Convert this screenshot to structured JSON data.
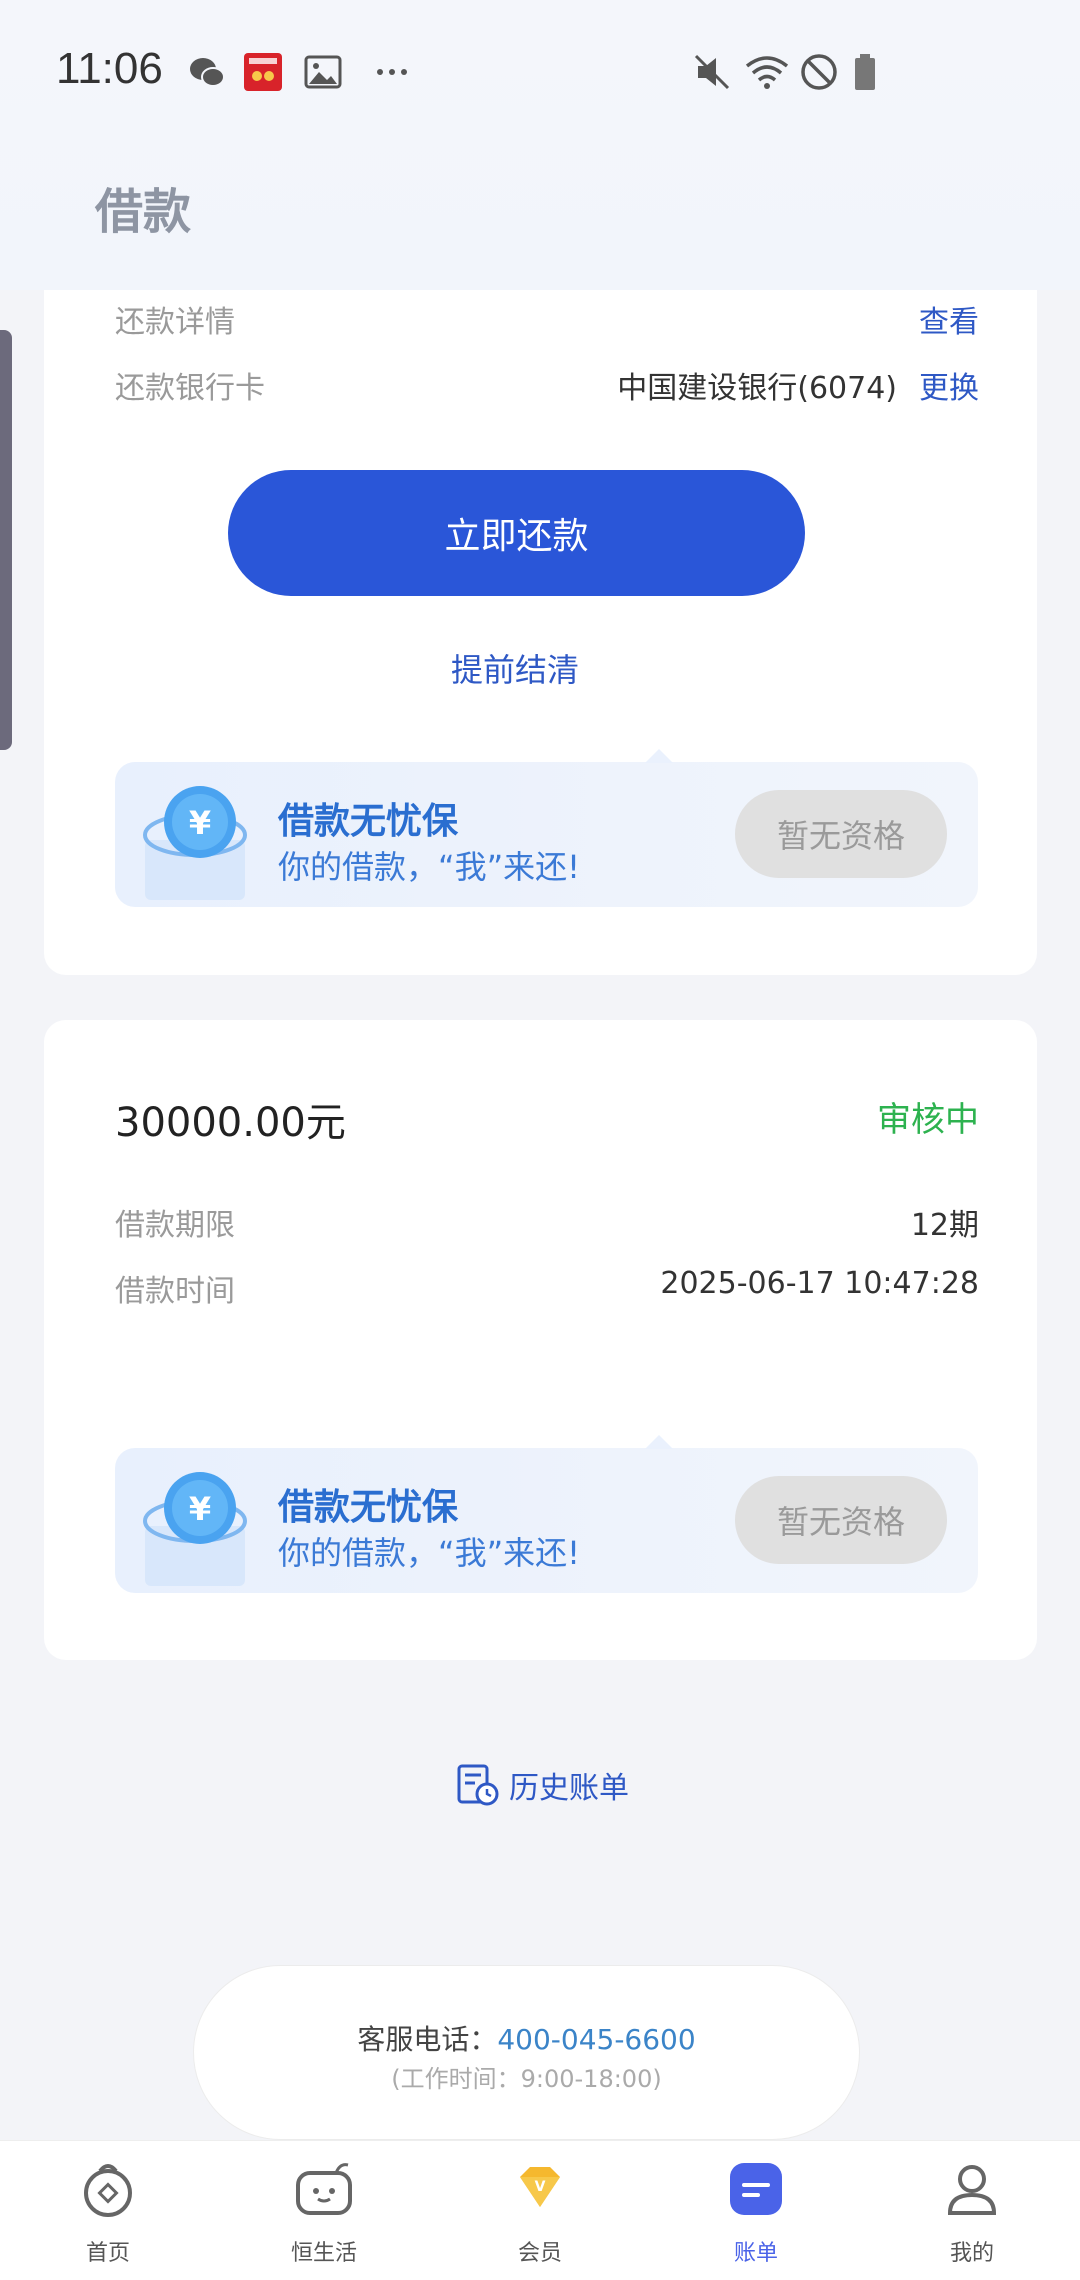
{
  "status_bar": {
    "time": "11:06",
    "icons": [
      "wechat-icon",
      "app-badge-icon",
      "gallery-icon",
      "more-dots-icon",
      "mute-icon",
      "wifi-icon",
      "no-disturb-icon",
      "battery-icon"
    ]
  },
  "header": {
    "title": "借款"
  },
  "loan1": {
    "detail_label": "还款详情",
    "detail_link": "查看",
    "bank_label": "还款银行卡",
    "bank_value": "中国建设银行(6074)",
    "bank_change": "更换",
    "repay_button": "立即还款",
    "settle_link": "提前结清",
    "banner": {
      "title": "借款无忧保",
      "subtitle": "你的借款，“我”来还!",
      "button": "暂无资格"
    }
  },
  "loan2": {
    "amount": "30000.00元",
    "status": "审核中",
    "term_label": "借款期限",
    "term_value": "12期",
    "time_label": "借款时间",
    "time_value": "2025-06-17 10:47:28",
    "banner": {
      "title": "借款无忧保",
      "subtitle": "你的借款，“我”来还!",
      "button": "暂无资格"
    }
  },
  "history": {
    "label": "历史账单",
    "icon": "history-bill-icon"
  },
  "service": {
    "phone_label": "客服电话：",
    "phone_number": "400-045-6600",
    "hours": "(工作时间：9:00-18:00)"
  },
  "tabbar": {
    "items": [
      {
        "label": "首页",
        "icon": "home-icon"
      },
      {
        "label": "恒生活",
        "icon": "life-icon"
      },
      {
        "label": "会员",
        "icon": "member-diamond-icon"
      },
      {
        "label": "账单",
        "icon": "bill-icon",
        "active": true
      },
      {
        "label": "我的",
        "icon": "profile-icon"
      }
    ]
  },
  "colors": {
    "primary": "#2a56d8",
    "link": "#2e58c5",
    "status_green": "#2db24f",
    "tab_active": "#4a63e8"
  }
}
